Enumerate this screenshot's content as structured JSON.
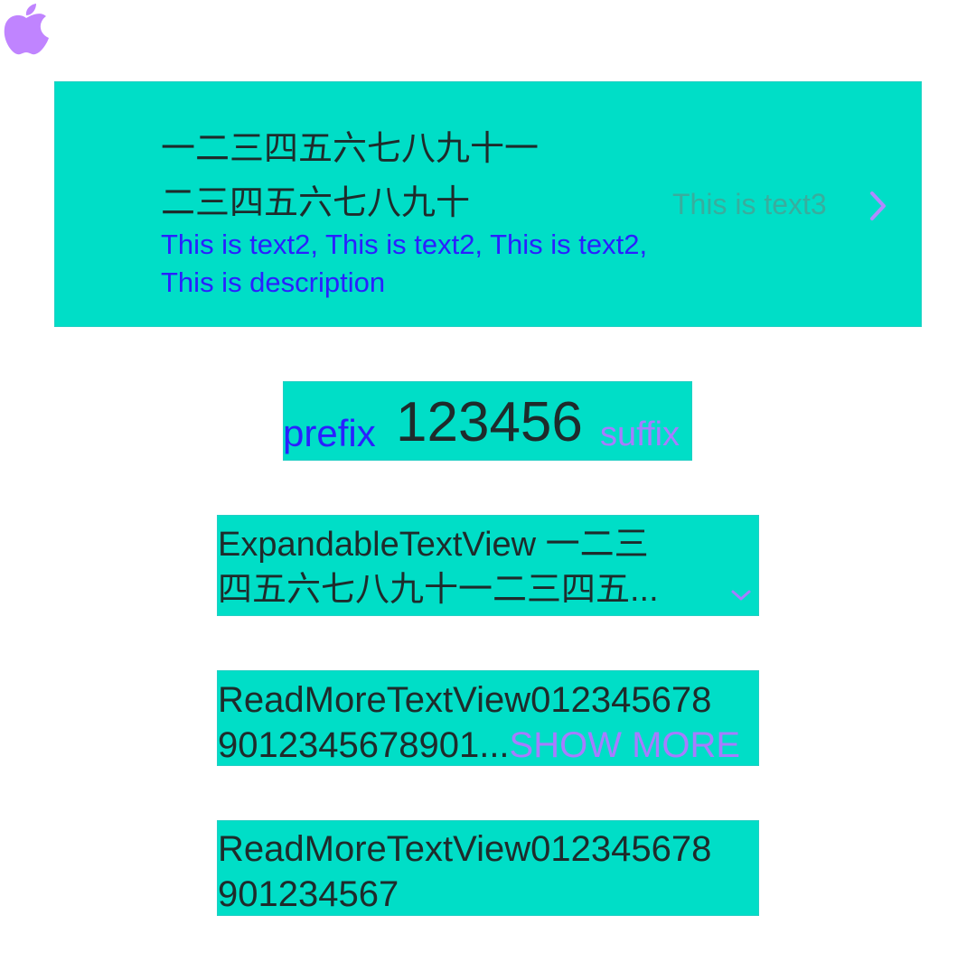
{
  "card1": {
    "icon": "apple-icon",
    "title_line1": "一二三四五六七八九十一",
    "title_line2": "二三四五六七八九十",
    "subtitle": "This is text2, This is text2, This is text2, This is description",
    "text3": "This is text3",
    "chevron": "chevron-right-icon"
  },
  "card2": {
    "prefix": "prefix",
    "number": "123456",
    "suffix": "suffix"
  },
  "card3": {
    "text": "ExpandableTextView 一二三\n四五六七八九十一二三四五...",
    "chevron": "chevron-down-icon"
  },
  "card4": {
    "text": "ReadMoreTextView012345678\n9012345678901...",
    "show_more": "SHOW MORE"
  },
  "card5": {
    "text": "ReadMoreTextView012345678\n901234567"
  },
  "colors": {
    "card_bg": "#00DEC7",
    "primary_text": "#1e2b2b",
    "blue_text": "#2a20ff",
    "purple": "#a77cff"
  }
}
